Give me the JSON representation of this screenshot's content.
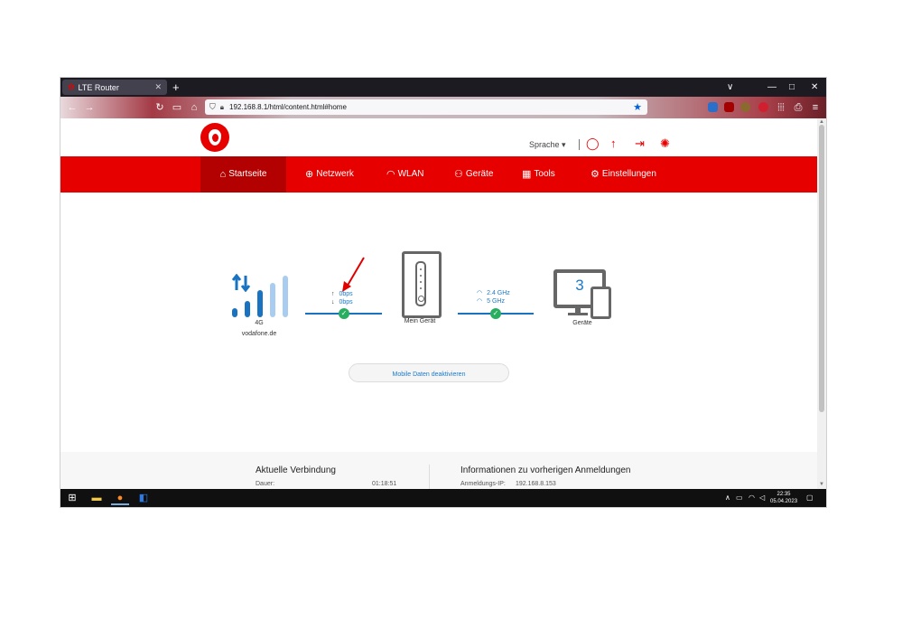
{
  "browser": {
    "tab_title": "LTE Router",
    "new_tab": "+",
    "url": "192.168.8.1/html/content.html#home",
    "controls": {
      "chevron": "∨",
      "minimize": "—",
      "maximize": "□",
      "close": "✕"
    }
  },
  "header": {
    "language_label": "Sprache ▾",
    "icons": [
      "chat-icon",
      "upload-icon",
      "logout-icon",
      "loading-icon"
    ]
  },
  "nav": {
    "items": [
      {
        "label": "Startseite",
        "icon": "home-icon",
        "active": true
      },
      {
        "label": "Netzwerk",
        "icon": "globe-icon"
      },
      {
        "label": "WLAN",
        "icon": "wifi-icon"
      },
      {
        "label": "Geräte",
        "icon": "devices-icon"
      },
      {
        "label": "Tools",
        "icon": "tools-icon"
      },
      {
        "label": "Einstellungen",
        "icon": "gear-icon"
      }
    ]
  },
  "diagram": {
    "network_type": "4G",
    "provider": "vodafone.de",
    "upload_rate": "0bps",
    "download_rate": "0bps",
    "router_label": "Mein Gerät",
    "band_1": "2.4 GHz",
    "band_2": "5 GHz",
    "devices_count": "3",
    "devices_label": "Geräte"
  },
  "actions": {
    "mobile_data_button": "Mobile Daten deaktivieren"
  },
  "panels": {
    "current_connection": {
      "title": "Aktuelle Verbindung",
      "duration_label": "Dauer:",
      "duration_value": "01:18:51"
    },
    "previous_logins": {
      "title": "Informationen zu vorherigen Anmeldungen",
      "ip_label": "Anmeldungs-IP:",
      "ip_value": "192.168.8.153"
    }
  },
  "taskbar": {
    "time": "22:35",
    "date": "05.04.2023"
  },
  "colors": {
    "brand_red": "#e60000",
    "accent_blue": "#1c7ac7",
    "ok_green": "#27ae60"
  }
}
